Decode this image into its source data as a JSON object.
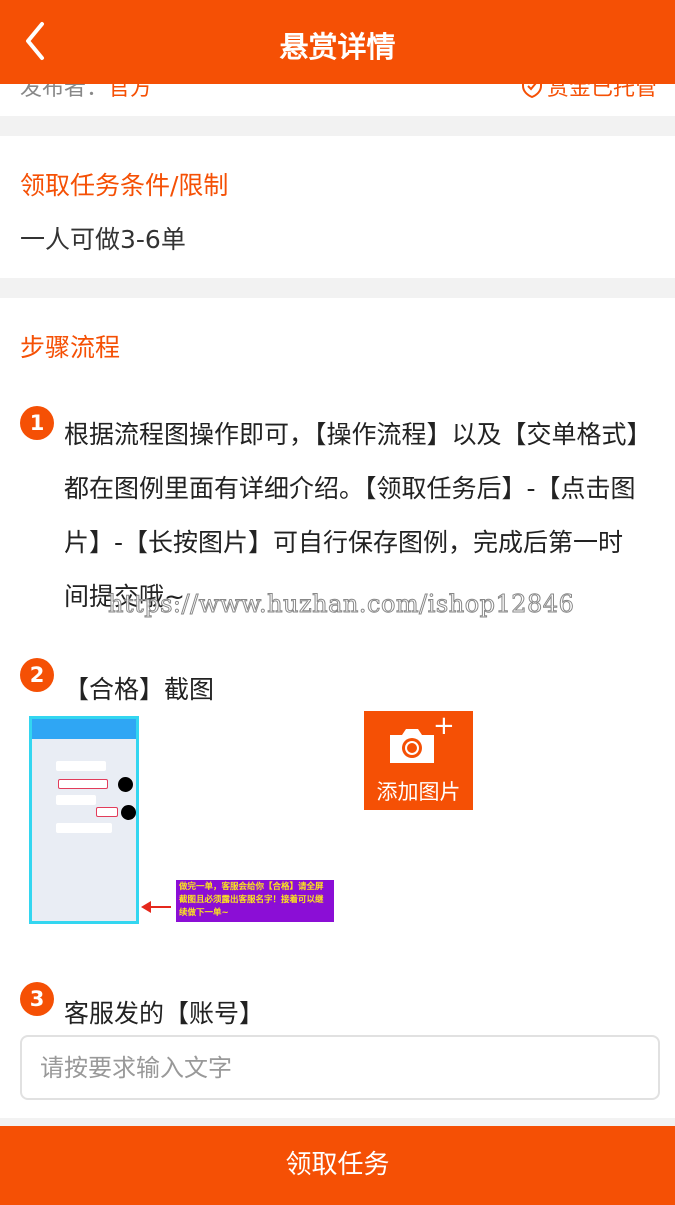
{
  "header": {
    "title": "悬赏详情",
    "back_icon": "chevron-left-icon"
  },
  "info": {
    "publisher_label": "发布者：",
    "publisher_value": "官方",
    "escrow_text": "赏金已托管"
  },
  "conditions": {
    "title": "领取任务条件/限制",
    "text": "一人可做3-6单"
  },
  "steps": {
    "title": "步骤流程",
    "items": [
      {
        "number": "1",
        "text": "根据流程图操作即可，【操作流程】以及【交单格式】都在图例里面有详细介绍。【领取任务后】-【点击图片】-【长按图片】可自行保存图例，完成后第一时间提交哦~"
      },
      {
        "number": "2",
        "text": "【合格】截图",
        "note": "做完一单，客服会给你【合格】请全屏截图且必须露出客服名字！接着可以继续做下一单~",
        "add_image_label": "添加图片"
      },
      {
        "number": "3",
        "text": "客服发的【账号】",
        "placeholder": "请按要求输入文字"
      }
    ]
  },
  "watermark": "https://www.huzhan.com/ishop12846",
  "claim_button": "领取任务",
  "colors": {
    "accent": "#f55005"
  }
}
